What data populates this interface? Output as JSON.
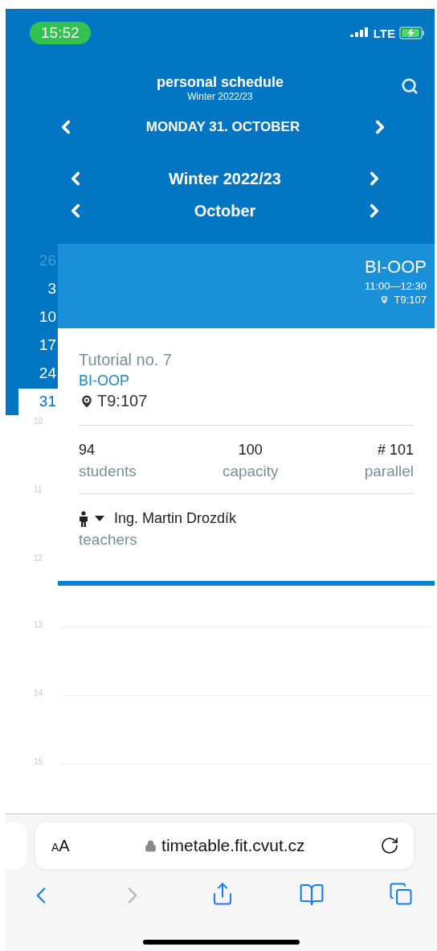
{
  "status_bar": {
    "time": "15:52",
    "network": "LTE"
  },
  "header": {
    "title": "personal schedule",
    "subtitle": "Winter 2022/23",
    "day": "MONDAY 31. OCTOBER",
    "semester": "Winter 2022/23",
    "month": "October"
  },
  "weeks": [
    {
      "label": "26",
      "selected": false,
      "muted": true
    },
    {
      "label": "3",
      "selected": false,
      "muted": false
    },
    {
      "label": "10",
      "selected": false,
      "muted": false
    },
    {
      "label": "17",
      "selected": false,
      "muted": false
    },
    {
      "label": "24",
      "selected": false,
      "muted": false
    },
    {
      "label": "31",
      "selected": true,
      "muted": false
    }
  ],
  "event": {
    "code": "BI-OOP",
    "time": "11:00—12:30",
    "room": "T9:107"
  },
  "detail": {
    "title": "Tutorial no. 7",
    "code": "BI-OOP",
    "room": "T9:107",
    "stats": [
      {
        "value": "94",
        "label": "students"
      },
      {
        "value": "100",
        "label": "capacity"
      },
      {
        "value": "# 101",
        "label": "parallel"
      }
    ],
    "teachers": [
      {
        "name": "Ing. Martin Drozdík",
        "expanded": false
      }
    ],
    "teachers_label": "teachers"
  },
  "hours": [
    "10",
    "11",
    "12",
    "13",
    "14",
    "15"
  ],
  "browser": {
    "text_size": "AA",
    "url": "timetable.fit.cvut.cz",
    "toolbar": [
      {
        "kind": "back",
        "disabled": false
      },
      {
        "kind": "forward",
        "disabled": true
      },
      {
        "kind": "share",
        "disabled": false
      },
      {
        "kind": "bookmarks",
        "disabled": false
      },
      {
        "kind": "tabs",
        "disabled": false
      }
    ]
  }
}
